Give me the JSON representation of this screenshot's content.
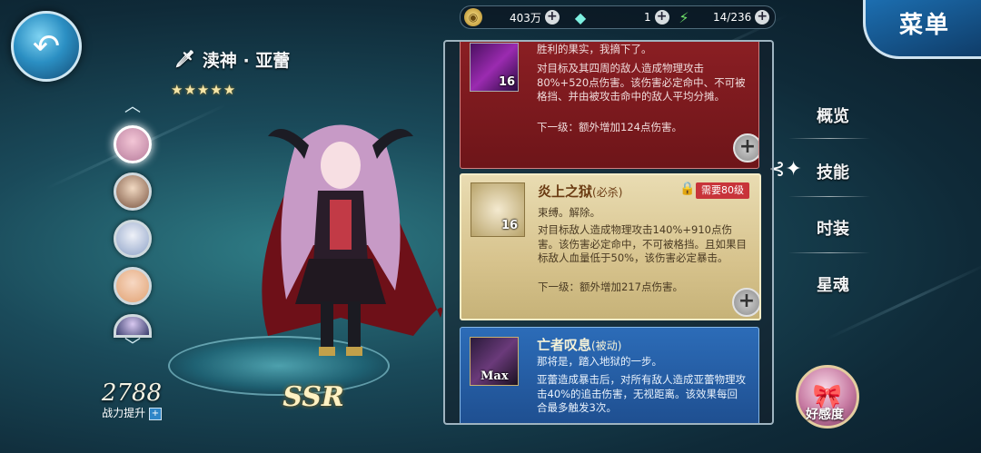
{
  "menu": {
    "label": "菜单"
  },
  "resources": {
    "gold": "403万",
    "crystal": "1",
    "stamina": "14/236"
  },
  "character": {
    "name": "渎神 · 亚蕾",
    "stars": "★★★★★",
    "rarity": "SSR",
    "power_value": "2788",
    "power_label": "战力提升"
  },
  "tabs": [
    "概览",
    "技能",
    "时装",
    "星魂"
  ],
  "active_tab": "技能",
  "favor_label": "好感度",
  "skills": [
    {
      "level": "16",
      "head_text": "胜利的果实，我摘下了。",
      "desc": "对目标及其四周的敌人造成物理攻击80%+520点伤害。该伤害必定命中、不可被格挡、并由被攻击命中的敌人平均分摊。",
      "next_level": "下一级：额外增加124点伤害。"
    },
    {
      "title": "炎上之狱",
      "tag": "(必杀)",
      "requirement": "需要80级",
      "level": "16",
      "flavor": "束缚。解除。",
      "desc": "对目标敌人造成物理攻击140%+910点伤害。该伤害必定命中，不可被格挡。且如果目标敌人血量低于50%，该伤害必定暴击。",
      "next_level": "下一级：额外增加217点伤害。"
    },
    {
      "title": "亡者叹息",
      "tag": "(被动)",
      "level": "Max",
      "flavor": "那将是，踏入地狱的一步。",
      "desc": "亚蕾造成暴击后，对所有敌人造成亚蕾物理攻击40%的追击伤害，无视距离。该效果每回合最多触发3次。"
    }
  ],
  "colors": {
    "card_red": "#8c1f24",
    "card_gold": "#e9dcb2",
    "card_blue": "#2c6cb8",
    "requirement_badge": "#c8343a"
  }
}
